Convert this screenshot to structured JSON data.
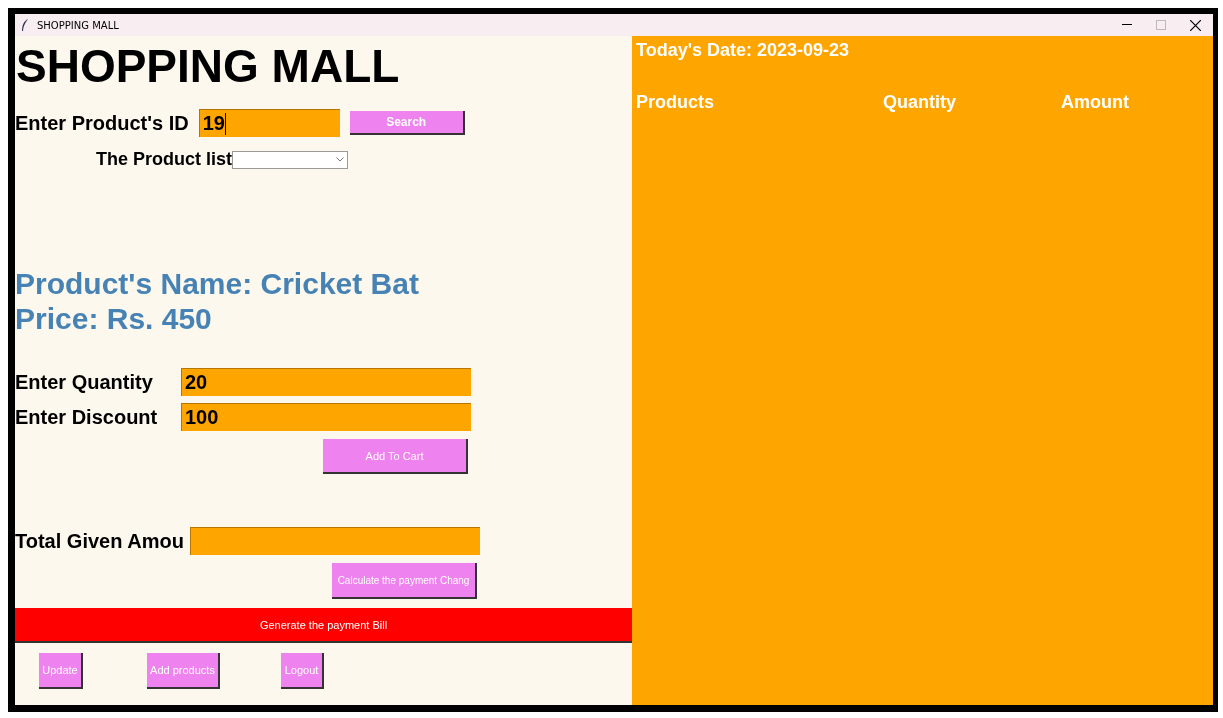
{
  "window": {
    "title": "SHOPPING MALL"
  },
  "heading": "SHOPPING MALL",
  "product_id": {
    "label": "Enter Product's ID",
    "value": "19"
  },
  "search_button": "Search",
  "product_list": {
    "label": "The Product list"
  },
  "product_name": "Product's Name: Cricket Bat",
  "price": "Price: Rs. 450",
  "quantity": {
    "label": "Enter Quantity",
    "value": "20"
  },
  "discount": {
    "label": "Enter Discount",
    "value": "100"
  },
  "add_to_cart": "Add To Cart",
  "total_given": {
    "label": "Total Given Amou"
  },
  "calculate_button": "Calculate the payment Chang",
  "generate_bill": "Generate the payment Bill",
  "bottom_buttons": [
    "Update",
    "Add products",
    "Logout"
  ],
  "date": "Today's Date: 2023-09-23",
  "columns": [
    "Products",
    "Quantity",
    "Amount"
  ]
}
